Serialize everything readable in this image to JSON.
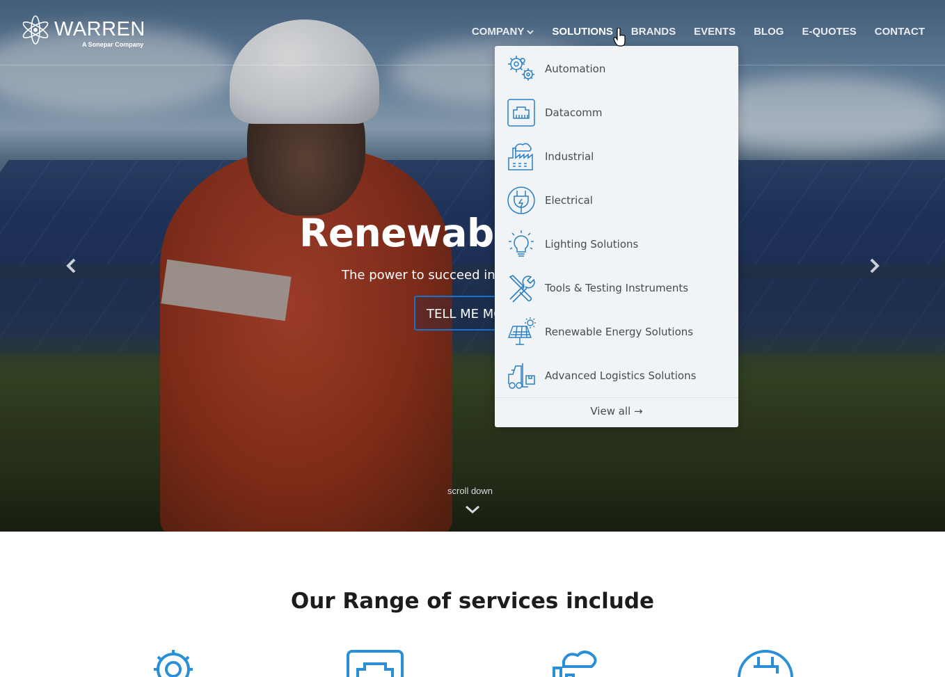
{
  "brand": {
    "name": "WARREN",
    "tagline": "A Sonepar Company"
  },
  "nav": {
    "items": [
      {
        "label": "COMPANY",
        "has_dropdown": true
      },
      {
        "label": "SOLUTIONS",
        "active": true
      },
      {
        "label": "BRANDS"
      },
      {
        "label": "EVENTS"
      },
      {
        "label": "BLOG"
      },
      {
        "label": "E-QUOTES"
      },
      {
        "label": "CONTACT"
      }
    ]
  },
  "hero": {
    "title": "Renewable",
    "subtitle": "The power to succeed in",
    "cta": "TELL ME MO",
    "scroll_label": "scroll down"
  },
  "solutions_menu": {
    "items": [
      {
        "label": "Automation",
        "icon": "gears-icon"
      },
      {
        "label": "Datacomm",
        "icon": "network-port-icon"
      },
      {
        "label": "Industrial",
        "icon": "factory-icon"
      },
      {
        "label": "Electrical",
        "icon": "plug-icon"
      },
      {
        "label": "Lighting Solutions",
        "icon": "lightbulb-icon"
      },
      {
        "label": "Tools & Testing Instruments",
        "icon": "tools-icon"
      },
      {
        "label": "Renewable Energy Solutions",
        "icon": "solar-panel-icon"
      },
      {
        "label": "Advanced Logistics Solutions",
        "icon": "forklift-icon"
      }
    ],
    "view_all": "View all →"
  },
  "services": {
    "title": "Our Range of services include"
  },
  "colors": {
    "accent": "#1a73c9",
    "dropdown_bg": "#f1f4f7",
    "icon_blue": "#2a7fc4"
  }
}
